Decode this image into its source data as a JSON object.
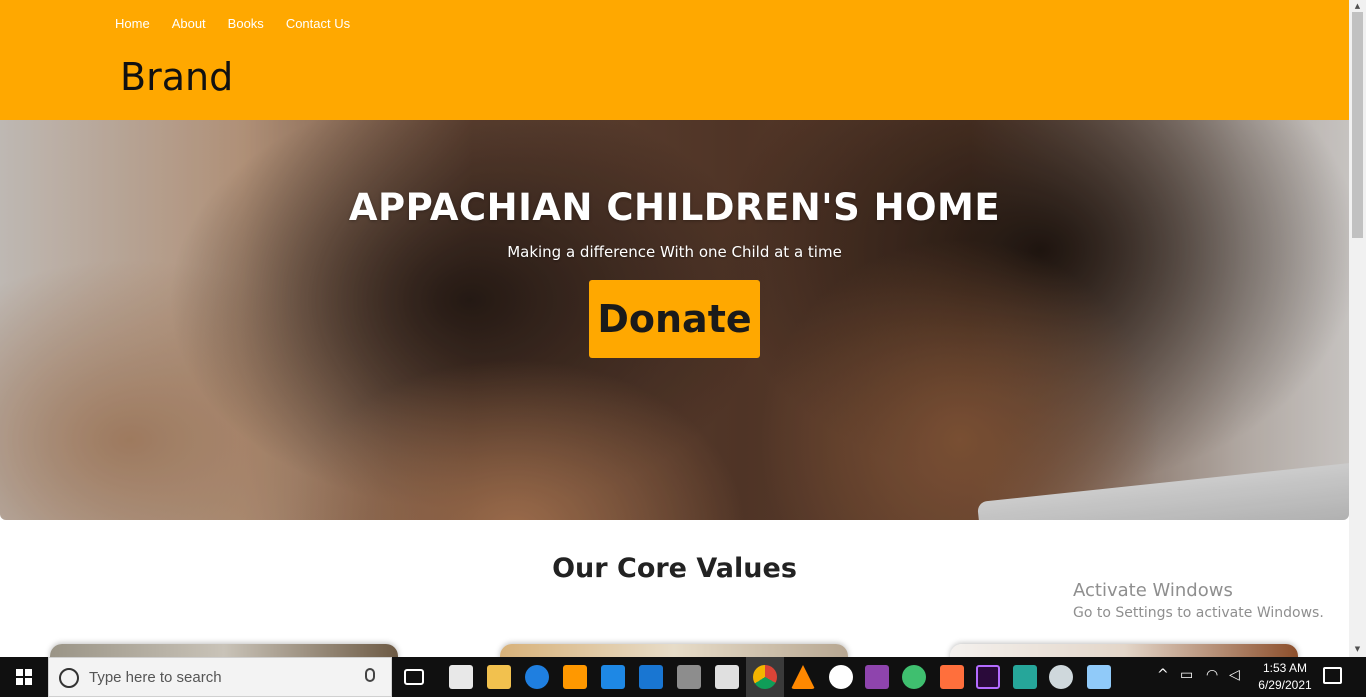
{
  "nav": {
    "items": [
      "Home",
      "About",
      "Books",
      "Contact Us"
    ]
  },
  "brand": "Brand",
  "hero": {
    "title": "APPACHIAN CHILDREN'S HOME",
    "subtitle": "Making a difference With one Child at a time",
    "donate_label": "Donate"
  },
  "core_values": {
    "title": "Our Core Values"
  },
  "watermark": {
    "line1": "Activate Windows",
    "line2": "Go to Settings to activate Windows."
  },
  "taskbar": {
    "search_placeholder": "Type here to search",
    "time": "1:53 AM",
    "date": "6/29/2021",
    "pinned": [
      "task-view-icon",
      "mail-icon",
      "file-explorer-icon",
      "edge-icon",
      "sublime-text-icon",
      "vscode-icon",
      "notepad-icon",
      "paint-icon",
      "store-icon",
      "chrome-icon",
      "vlc-icon",
      "app-green-icon",
      "visual-studio-icon",
      "app-sphere-icon",
      "app-orange-icon",
      "premiere-icon",
      "app-arrow-icon",
      "settings-icon",
      "app-book-icon"
    ]
  },
  "colors": {
    "accent": "#ffa800",
    "taskbar": "#101010"
  }
}
